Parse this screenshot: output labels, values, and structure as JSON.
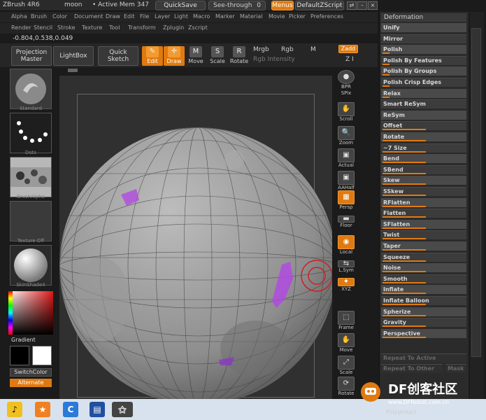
{
  "titlebar": {
    "app": "ZBrush 4R6",
    "doc": "moon",
    "mem": "• Active Mem 347",
    "quicksave": "QuickSave",
    "seethrough": "See-through",
    "seethrough_value": "0",
    "menus": "Menus",
    "script": "DefaultZScript"
  },
  "menus": {
    "row1": [
      "Alpha",
      "Brush",
      "Color",
      "Document",
      "Draw",
      "Edit",
      "File",
      "Layer",
      "Light",
      "Macro",
      "Marker",
      "Material",
      "Movie",
      "Picker",
      "Preferences"
    ],
    "row2": [
      "Render",
      "Stencil",
      "Stroke",
      "Texture",
      "Tool",
      "Transform",
      "Zplugin",
      "Zscript"
    ]
  },
  "coords": "-0.804,0.538,0.049",
  "toolbar": {
    "projection_master": [
      "Projection",
      "Master"
    ],
    "lightbox": "LightBox",
    "quick_sketch": [
      "Quick",
      "Sketch"
    ],
    "edit": "Edit",
    "draw": "Draw",
    "move": "Move",
    "scale": "Scale",
    "rotate": "Rotate",
    "mrgb": "Mrgb",
    "rgb": "Rgb",
    "m": "M",
    "zadd": "Zadd",
    "rgb_intensity": "Rgb Intensity",
    "z_label": "Z I"
  },
  "shelf": {
    "standard": "Standard",
    "dots": "Dots",
    "brushalpha": "BrushAlpha",
    "texture_off": "Texture  Off",
    "skinshade": "SkinShade4",
    "gradient": "Gradient",
    "switchcolor": "SwitchColor",
    "alternate": "Alternate"
  },
  "righttools": [
    {
      "label": "BPR",
      "icon": "●"
    },
    {
      "label": "SPix",
      "icon": ""
    },
    {
      "label": "Scroll",
      "icon": "✋"
    },
    {
      "label": "Zoom",
      "icon": "🔍"
    },
    {
      "label": "Actual",
      "icon": "▣"
    },
    {
      "label": "AAHalf",
      "icon": "▣"
    },
    {
      "label": "Persp",
      "icon": "▦"
    },
    {
      "label": "Floor",
      "icon": "▬"
    },
    {
      "label": "Local",
      "icon": "◉"
    },
    {
      "label": "L.Sym",
      "icon": "⇆"
    },
    {
      "label": "XYZ",
      "icon": "✦"
    },
    {
      "label": "Frame",
      "icon": "⬚"
    },
    {
      "label": "Move",
      "icon": "✋"
    },
    {
      "label": "Scale",
      "icon": "⤢"
    },
    {
      "label": "Rotate",
      "icon": "⟳"
    }
  ],
  "panel": {
    "title": "Deformation",
    "rows": [
      "Unify",
      "Mirror",
      "Polish",
      "Polish By Features",
      "Polish By Groups",
      "Polish Crisp Edges",
      "Relax",
      "Smart ReSym",
      "ReSym",
      "Offset",
      "Rotate",
      "~7 Size",
      "Bend",
      "SBend",
      "Skew",
      "SSkew",
      "RFlatten",
      "Flatten",
      "SFlatten",
      "Twist",
      "Taper",
      "Squeeze",
      "Noise",
      "Smooth",
      "Inflate",
      "Inflate Balloon",
      "Spherize",
      "Gravity",
      "Perspective"
    ],
    "repeat_active": "Repeat To Active",
    "repeat_other": "Repeat To Other",
    "mask": "Mask",
    "polygroups": "Polygroups"
  },
  "watermark": {
    "text": "DF创客社区",
    "url": "www.DFRobot.com.cn"
  },
  "colors": {
    "accent": "#e07a10",
    "panel": "#2b2b2b",
    "background": "#1b1b1b"
  }
}
